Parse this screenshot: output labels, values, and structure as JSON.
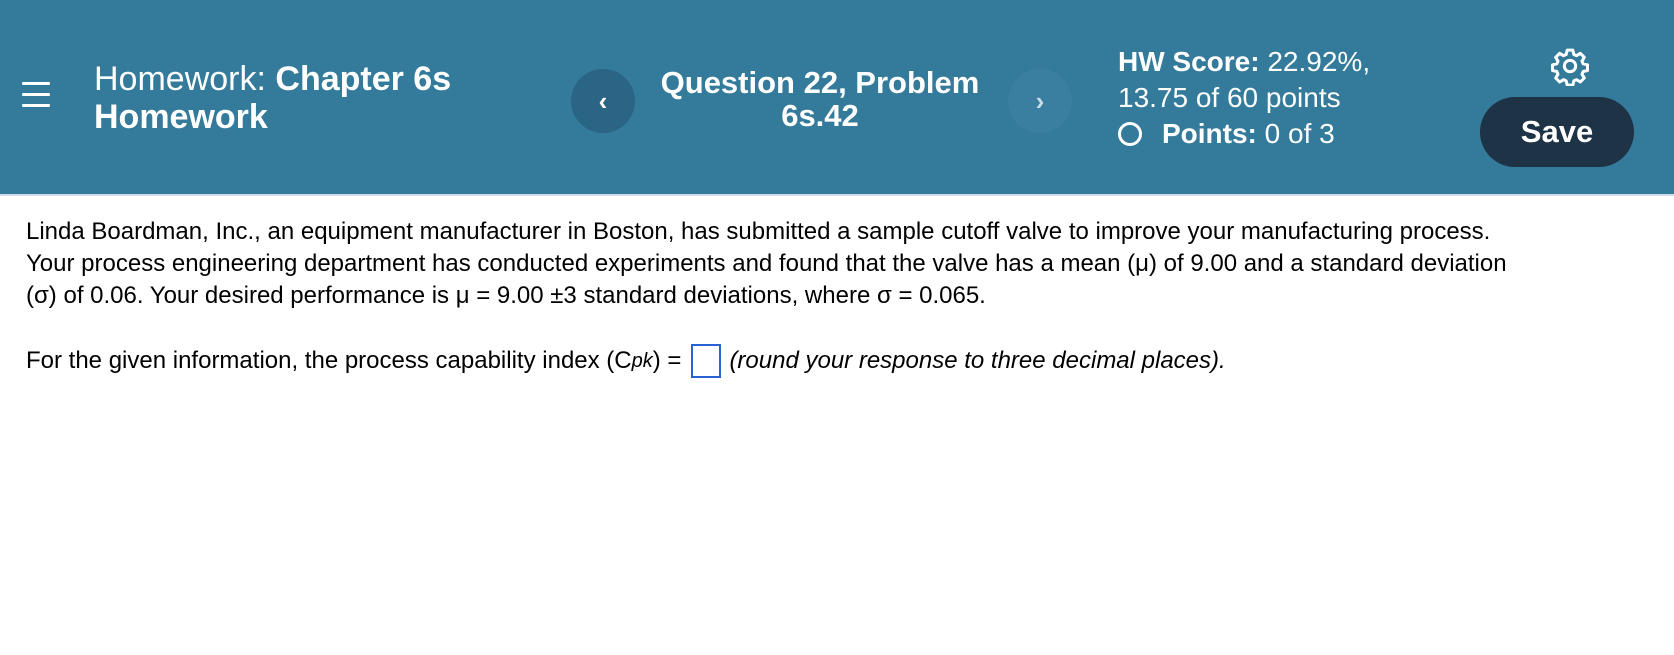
{
  "header": {
    "homework_prefix": "Homework:",
    "homework_name_line1": "Chapter 6s",
    "homework_name_line2": "Homework",
    "question_line1": "Question 22, Problem",
    "question_line2": "6s.42",
    "prev_label": "‹",
    "next_label": "›",
    "hw_score_label": "HW Score:",
    "hw_score_value": "22.92%,",
    "points_total": "13.75 of 60 points",
    "points_label": "Points:",
    "points_value": "0 of 3",
    "save_label": "Save"
  },
  "problem": {
    "line1": "Linda Boardman, Inc., an equipment manufacturer in Boston, has submitted a sample cutoff valve to improve your manufacturing process.",
    "line2": "Your process engineering department has conducted experiments and found that the valve has a mean (μ) of 9.00 and a standard deviation",
    "line3": "(σ) of 0.06.  Your desired performance is μ = 9.00  ±3 standard deviations, where σ = 0.065.",
    "question_before": "For the given information, the process capability index (C",
    "question_sub": "pk",
    "question_after": ") =",
    "answer_value": "",
    "hint": "(round your response to three decimal places)."
  },
  "icons": {
    "menu": "hamburger-menu-icon",
    "settings": "gear-icon",
    "status": "radio-circle-icon"
  },
  "colors": {
    "header_bg": "#347a9b",
    "save_bg": "#1f3347",
    "input_border": "#2a62d6"
  }
}
